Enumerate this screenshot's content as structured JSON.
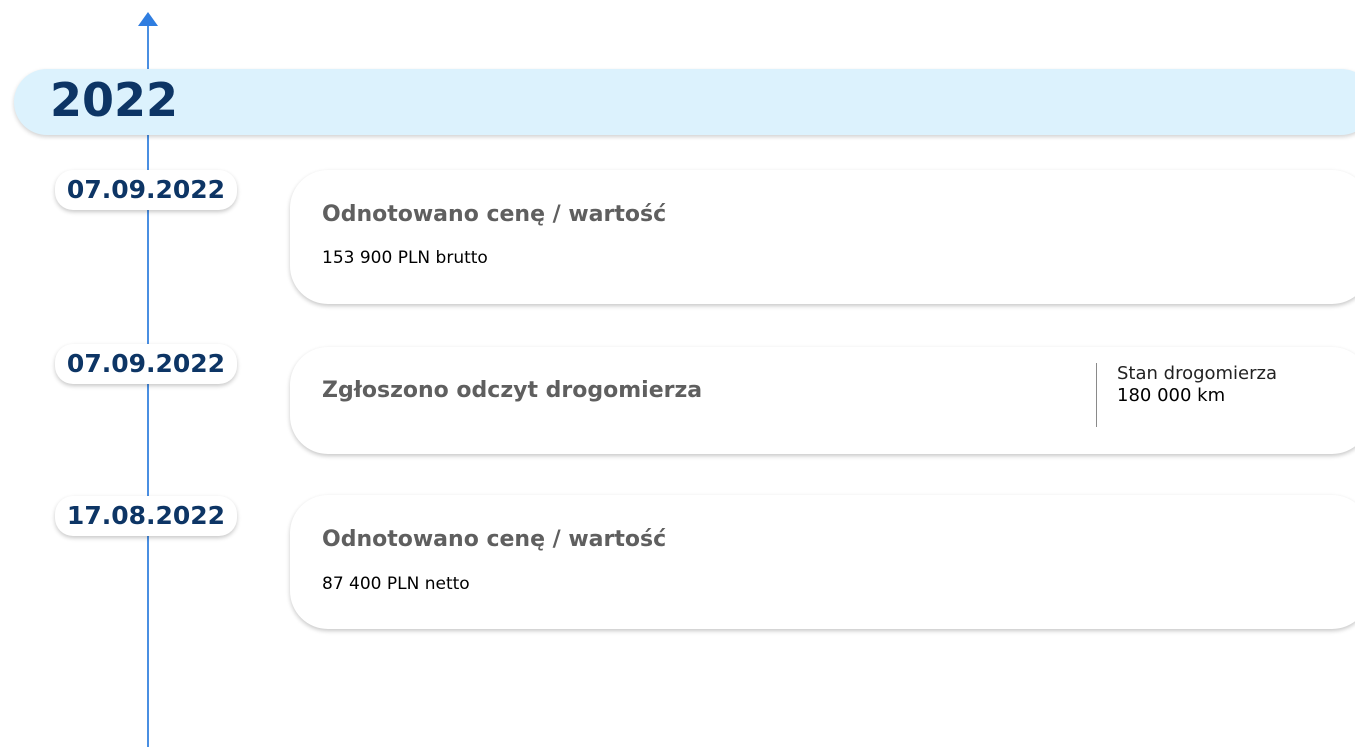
{
  "year": "2022",
  "colors": {
    "axis": "#4a8fe2",
    "year_bar": "#dcf2fd",
    "year_text": "#0d3565",
    "card_title": "#5f5f5f"
  },
  "events": [
    {
      "date": "07.09.2022",
      "title": "Odnotowano cenę / wartość",
      "value": "153 900 PLN brutto"
    },
    {
      "date": "07.09.2022",
      "title": "Zgłoszono odczyt drogomierza",
      "odometer_label": "Stan drogomierza",
      "odometer_value": "180 000 km"
    },
    {
      "date": "17.08.2022",
      "title": "Odnotowano cenę / wartość",
      "value": "87 400 PLN netto"
    }
  ]
}
